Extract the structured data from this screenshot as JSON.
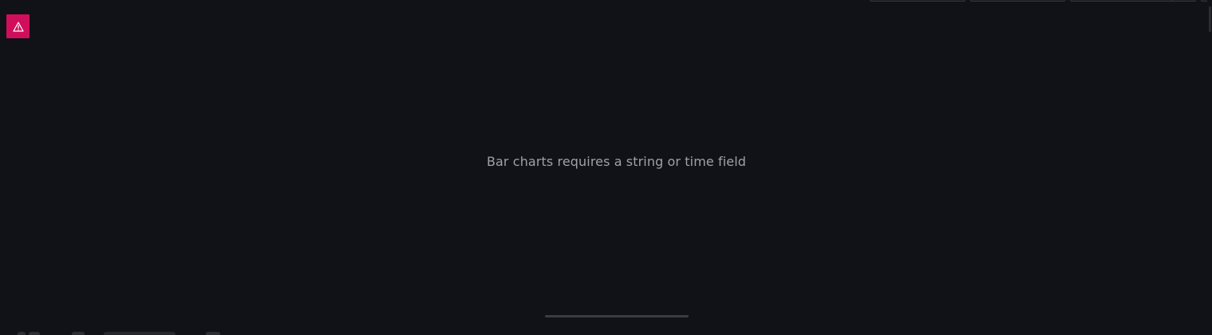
{
  "panel": {
    "error_icon": "warning-triangle-icon",
    "accent_color": "#d10e5c",
    "message": "Bar charts requires a string or time field"
  },
  "toolbar": {
    "controls": [
      "",
      "",
      "",
      ""
    ]
  }
}
